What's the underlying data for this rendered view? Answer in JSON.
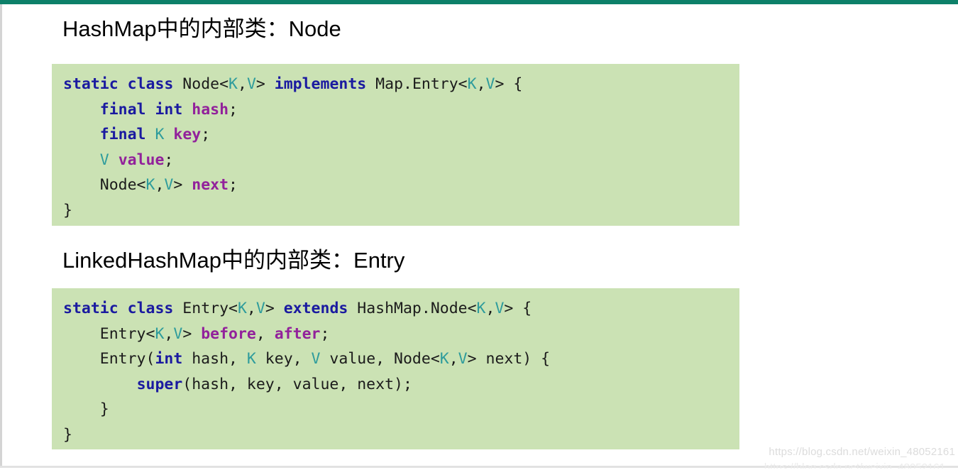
{
  "page": {
    "accent_color": "#0d8069",
    "code_background": "#cbe2b4",
    "keyword_color": "#1a1aa0",
    "type_param_color": "#2e9c9c",
    "field_name_color": "#92219b",
    "text_color": "#1b1b1b"
  },
  "sections": [
    {
      "heading": "HashMap中的内部类：Node",
      "code_lines": [
        [
          {
            "t": "static",
            "c": "keyword"
          },
          {
            "t": " ",
            "c": "plain"
          },
          {
            "t": "class",
            "c": "keyword"
          },
          {
            "t": " Node<",
            "c": "plain"
          },
          {
            "t": "K",
            "c": "type"
          },
          {
            "t": ",",
            "c": "plain"
          },
          {
            "t": "V",
            "c": "type"
          },
          {
            "t": "> ",
            "c": "plain"
          },
          {
            "t": "implements",
            "c": "keyword"
          },
          {
            "t": " Map.Entry<",
            "c": "plain"
          },
          {
            "t": "K",
            "c": "type"
          },
          {
            "t": ",",
            "c": "plain"
          },
          {
            "t": "V",
            "c": "type"
          },
          {
            "t": "> {",
            "c": "plain"
          }
        ],
        [
          {
            "t": "    ",
            "c": "plain"
          },
          {
            "t": "final",
            "c": "keyword"
          },
          {
            "t": " ",
            "c": "plain"
          },
          {
            "t": "int",
            "c": "keyword"
          },
          {
            "t": " ",
            "c": "plain"
          },
          {
            "t": "hash",
            "c": "field"
          },
          {
            "t": ";",
            "c": "plain"
          }
        ],
        [
          {
            "t": "    ",
            "c": "plain"
          },
          {
            "t": "final",
            "c": "keyword"
          },
          {
            "t": " ",
            "c": "plain"
          },
          {
            "t": "K",
            "c": "type"
          },
          {
            "t": " ",
            "c": "plain"
          },
          {
            "t": "key",
            "c": "field"
          },
          {
            "t": ";",
            "c": "plain"
          }
        ],
        [
          {
            "t": "    ",
            "c": "plain"
          },
          {
            "t": "V",
            "c": "type"
          },
          {
            "t": " ",
            "c": "plain"
          },
          {
            "t": "value",
            "c": "field"
          },
          {
            "t": ";",
            "c": "plain"
          }
        ],
        [
          {
            "t": "    Node<",
            "c": "plain"
          },
          {
            "t": "K",
            "c": "type"
          },
          {
            "t": ",",
            "c": "plain"
          },
          {
            "t": "V",
            "c": "type"
          },
          {
            "t": "> ",
            "c": "plain"
          },
          {
            "t": "next",
            "c": "field"
          },
          {
            "t": ";",
            "c": "plain"
          }
        ],
        [
          {
            "t": "}",
            "c": "plain"
          }
        ]
      ]
    },
    {
      "heading": "LinkedHashMap中的内部类：Entry",
      "code_lines": [
        [
          {
            "t": "static",
            "c": "keyword"
          },
          {
            "t": " ",
            "c": "plain"
          },
          {
            "t": "class",
            "c": "keyword"
          },
          {
            "t": " Entry<",
            "c": "plain"
          },
          {
            "t": "K",
            "c": "type"
          },
          {
            "t": ",",
            "c": "plain"
          },
          {
            "t": "V",
            "c": "type"
          },
          {
            "t": "> ",
            "c": "plain"
          },
          {
            "t": "extends",
            "c": "keyword"
          },
          {
            "t": " HashMap.Node<",
            "c": "plain"
          },
          {
            "t": "K",
            "c": "type"
          },
          {
            "t": ",",
            "c": "plain"
          },
          {
            "t": "V",
            "c": "type"
          },
          {
            "t": "> {",
            "c": "plain"
          }
        ],
        [
          {
            "t": "    Entry<",
            "c": "plain"
          },
          {
            "t": "K",
            "c": "type"
          },
          {
            "t": ",",
            "c": "plain"
          },
          {
            "t": "V",
            "c": "type"
          },
          {
            "t": "> ",
            "c": "plain"
          },
          {
            "t": "before",
            "c": "field"
          },
          {
            "t": ", ",
            "c": "plain"
          },
          {
            "t": "after",
            "c": "field"
          },
          {
            "t": ";",
            "c": "plain"
          }
        ],
        [
          {
            "t": "    Entry(",
            "c": "plain"
          },
          {
            "t": "int",
            "c": "keyword"
          },
          {
            "t": " hash, ",
            "c": "plain"
          },
          {
            "t": "K",
            "c": "type"
          },
          {
            "t": " key, ",
            "c": "plain"
          },
          {
            "t": "V",
            "c": "type"
          },
          {
            "t": " value, Node<",
            "c": "plain"
          },
          {
            "t": "K",
            "c": "type"
          },
          {
            "t": ",",
            "c": "plain"
          },
          {
            "t": "V",
            "c": "type"
          },
          {
            "t": "> next) {",
            "c": "plain"
          }
        ],
        [
          {
            "t": "        ",
            "c": "plain"
          },
          {
            "t": "super",
            "c": "keyword"
          },
          {
            "t": "(hash, key, value, next);",
            "c": "plain"
          }
        ],
        [
          {
            "t": "    }",
            "c": "plain"
          }
        ],
        [
          {
            "t": "}",
            "c": "plain"
          }
        ]
      ]
    }
  ],
  "watermark": {
    "url": "https://blog.csdn.net/weixin_48052161"
  }
}
